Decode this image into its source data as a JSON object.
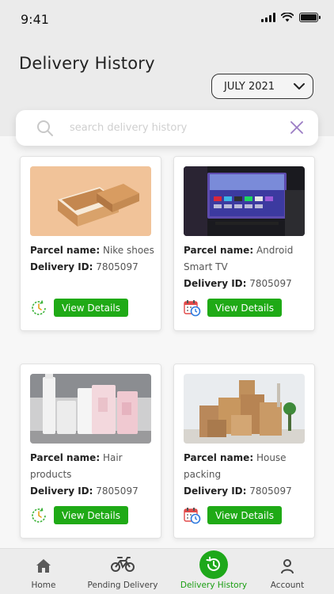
{
  "status_bar": {
    "time": "9:41"
  },
  "header": {
    "title": "Delivery History",
    "month_select": "JULY 2021"
  },
  "search": {
    "placeholder": "search delivery history",
    "value": ""
  },
  "cards": [
    {
      "parcel_label": "Parcel name:",
      "parcel_name": "Nike shoes",
      "delivery_label": "Delivery ID:",
      "delivery_id": "7805097",
      "button": "View Details",
      "status_icon": "refresh-clock-icon"
    },
    {
      "parcel_label": "Parcel name:",
      "parcel_name": "Android Smart TV",
      "delivery_label": "Delivery ID:",
      "delivery_id": "7805097",
      "button": "View Details",
      "status_icon": "calendar-clock-icon"
    },
    {
      "parcel_label": "Parcel name:",
      "parcel_name": "Hair products",
      "delivery_label": "Delivery ID:",
      "delivery_id": "7805097",
      "button": "View Details",
      "status_icon": "refresh-clock-icon"
    },
    {
      "parcel_label": "Parcel name:",
      "parcel_name": "House packing",
      "delivery_label": "Delivery ID:",
      "delivery_id": "7805097",
      "button": "View Details",
      "status_icon": "calendar-clock-icon"
    }
  ],
  "nav": {
    "home": "Home",
    "pending": "Pending Delivery",
    "history": "Delivery History",
    "account": "Account"
  },
  "colors": {
    "accent": "#1faa16",
    "active_nav": "#1a9e12",
    "clear_icon": "#9b7cc4"
  }
}
